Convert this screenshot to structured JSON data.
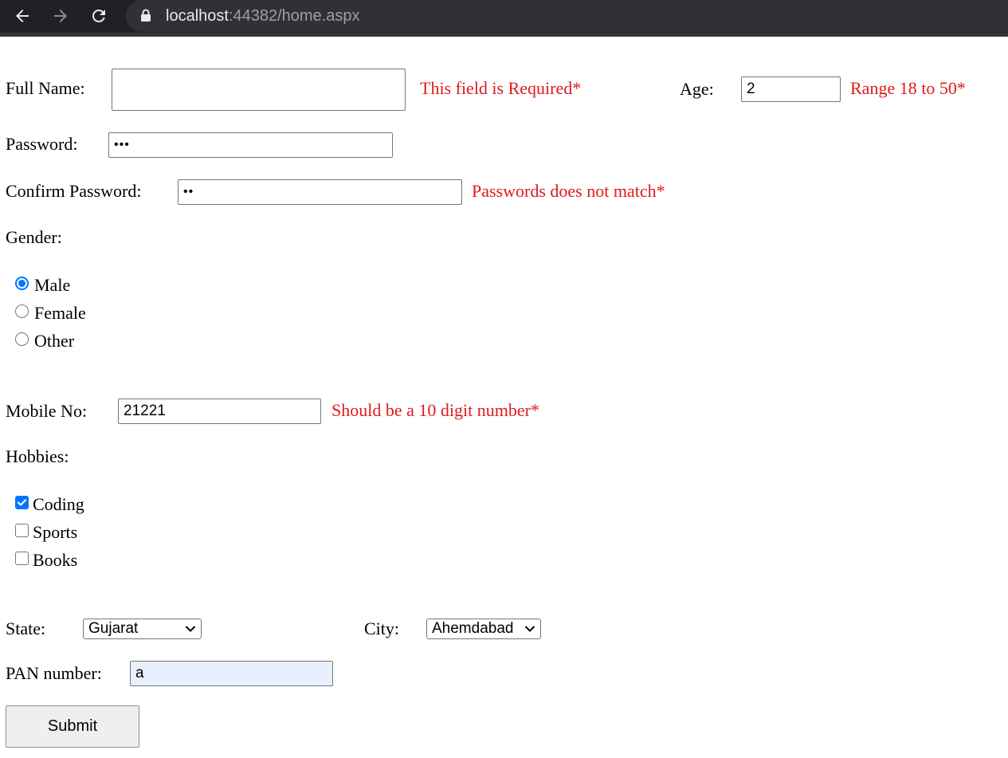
{
  "browser": {
    "url_host": "localhost",
    "url_rest": ":44382/home.aspx"
  },
  "form": {
    "full_name": {
      "label": "Full Name:",
      "value": "",
      "error": "This field is Required*"
    },
    "age": {
      "label": "Age:",
      "value": "2",
      "error": "Range 18 to 50*"
    },
    "password": {
      "label": "Password:",
      "value": "•••"
    },
    "confirm_password": {
      "label": "Confirm Password:",
      "value": "••",
      "error": "Passwords does not match*"
    },
    "gender": {
      "label": "Gender:",
      "options": [
        "Male",
        "Female",
        "Other"
      ],
      "selected": "Male"
    },
    "mobile": {
      "label": "Mobile No:",
      "value": "21221",
      "error": "Should be a 10 digit number*"
    },
    "hobbies": {
      "label": "Hobbies:",
      "options": [
        "Coding",
        "Sports",
        "Books"
      ],
      "checked": [
        "Coding"
      ]
    },
    "state": {
      "label": "State:",
      "selected": "Gujarat"
    },
    "city": {
      "label": "City:",
      "selected": "Ahemdabad"
    },
    "pan": {
      "label": "PAN number:",
      "value": "a"
    },
    "submit_label": "Submit"
  },
  "colors": {
    "error": "#e0191b",
    "accent": "#0075ff",
    "autofill": "#e8f0fe"
  },
  "icons": {
    "back": "back-arrow-icon",
    "forward": "forward-arrow-icon",
    "reload": "reload-icon",
    "lock": "lock-icon",
    "dropdown": "chevron-down-icon"
  }
}
